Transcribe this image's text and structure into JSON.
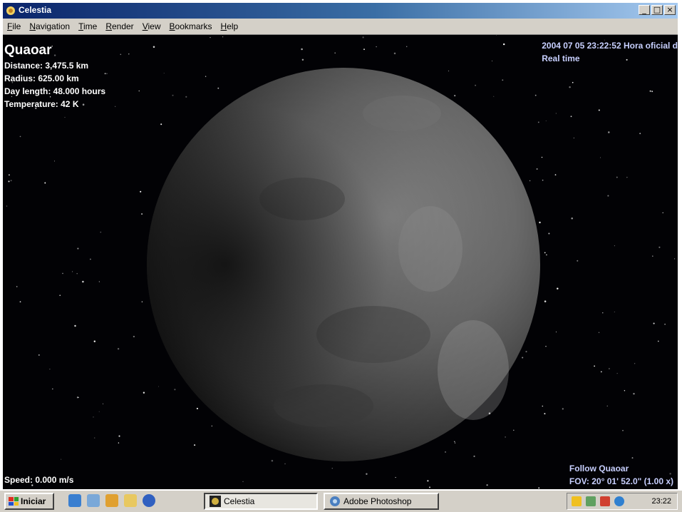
{
  "window": {
    "title": "Celestia",
    "minimize_glyph": "_",
    "maximize_glyph": "□",
    "close_glyph": "×"
  },
  "menu": [
    "File",
    "Navigation",
    "Time",
    "Render",
    "View",
    "Bookmarks",
    "Help"
  ],
  "hud": {
    "object_name": "Quaoar",
    "distance": "Distance: 3,475.5 km",
    "radius": "Radius: 625.00 km",
    "day_length": "Day length: 48.000 hours",
    "temperature": "Temperature: 42 K",
    "datetime": "2004 07 05 23:22:52 Hora oficial d",
    "time_mode": "Real time",
    "speed": "Speed: 0.000 m/s",
    "follow": "Follow Quaoar",
    "fov": "FOV: 20° 01' 52.0\" (1.00 x)"
  },
  "taskbar": {
    "start_label": "Iniciar",
    "tasks": [
      {
        "label": "Celestia",
        "active": true
      },
      {
        "label": "Adobe Photoshop",
        "active": false
      }
    ],
    "clock": "23:22"
  },
  "icons": {
    "app": "celestia-icon",
    "start": "windows-flag-icon",
    "quick_launch": [
      "ie-icon",
      "desktop-icon",
      "media-icon",
      "folder-icon",
      "browser-icon"
    ],
    "tray": [
      "volume-icon",
      "network-icon",
      "security-icon",
      "messenger-icon"
    ]
  }
}
